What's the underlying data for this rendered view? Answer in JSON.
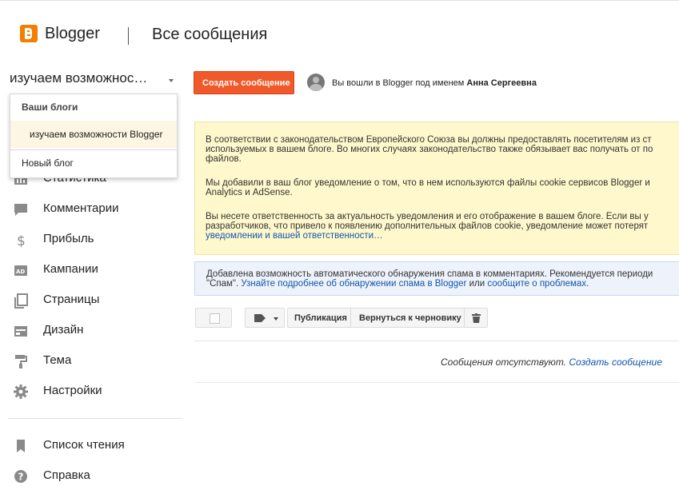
{
  "header": {
    "brand": "Blogger",
    "page_title": "Все сообщения"
  },
  "blog_selector": {
    "current": "изучаем возможнос…"
  },
  "dropdown": {
    "header": "Ваши блоги",
    "blogs": [
      "изучаем возможности Blogger"
    ],
    "new_blog": "Новый блог"
  },
  "sidebar": {
    "items": [
      {
        "label": "Статистика",
        "icon": "bar-chart-icon"
      },
      {
        "label": "Комментарии",
        "icon": "comment-icon"
      },
      {
        "label": "Прибыль",
        "icon": "dollar-icon"
      },
      {
        "label": "Кампании",
        "icon": "ad-icon"
      },
      {
        "label": "Страницы",
        "icon": "pages-icon"
      },
      {
        "label": "Дизайн",
        "icon": "layout-icon"
      },
      {
        "label": "Тема",
        "icon": "paint-roller-icon"
      },
      {
        "label": "Настройки",
        "icon": "gear-icon"
      }
    ],
    "bottom_items": [
      {
        "label": "Список чтения",
        "icon": "bookmark-icon"
      },
      {
        "label": "Справка",
        "icon": "help-icon"
      }
    ]
  },
  "main": {
    "create_button": "Создать сообщение",
    "signed_in_prefix": "Вы вошли в Blogger под именем",
    "user_name": "Анна Сергеевна",
    "cookie_notice": {
      "p1": "В соответствии с законодательством Европейского Союза вы должны предоставлять посетителям из ст",
      "p1b": "используемых в вашем блоге. Во многих случаях законодательство также обязывает вас получать от по",
      "p1c": "файлов.",
      "p2": "Мы добавили в ваш блог уведомление о том, что в нем используются файлы cookie сервисов Blogger и",
      "p2b": "Analytics и AdSense.",
      "p3": "Вы несете ответственность за актуальность уведомления и его отображение в вашем блоге. Если вы у",
      "p3b": "разработчиков, что привело к появлению дополнительных файлов cookie, уведомление может потерят",
      "p3_link": "уведомлении и вашей ответственности…"
    },
    "spam_notice": {
      "text": "Добавлена возможность автоматического обнаружения спама в комментариях. Рекомендуется периоди",
      "text2": "\"Спам\".",
      "link1": "Узнайте подробнее об обнаружении спама в Blogger",
      "or": "или",
      "link2": "сообщите о проблемах."
    },
    "toolbar": {
      "publish": "Публикация",
      "revert": "Вернуться к черновику"
    },
    "empty_text": "Сообщения отсутствуют.",
    "empty_link": "Создать сообщение"
  }
}
